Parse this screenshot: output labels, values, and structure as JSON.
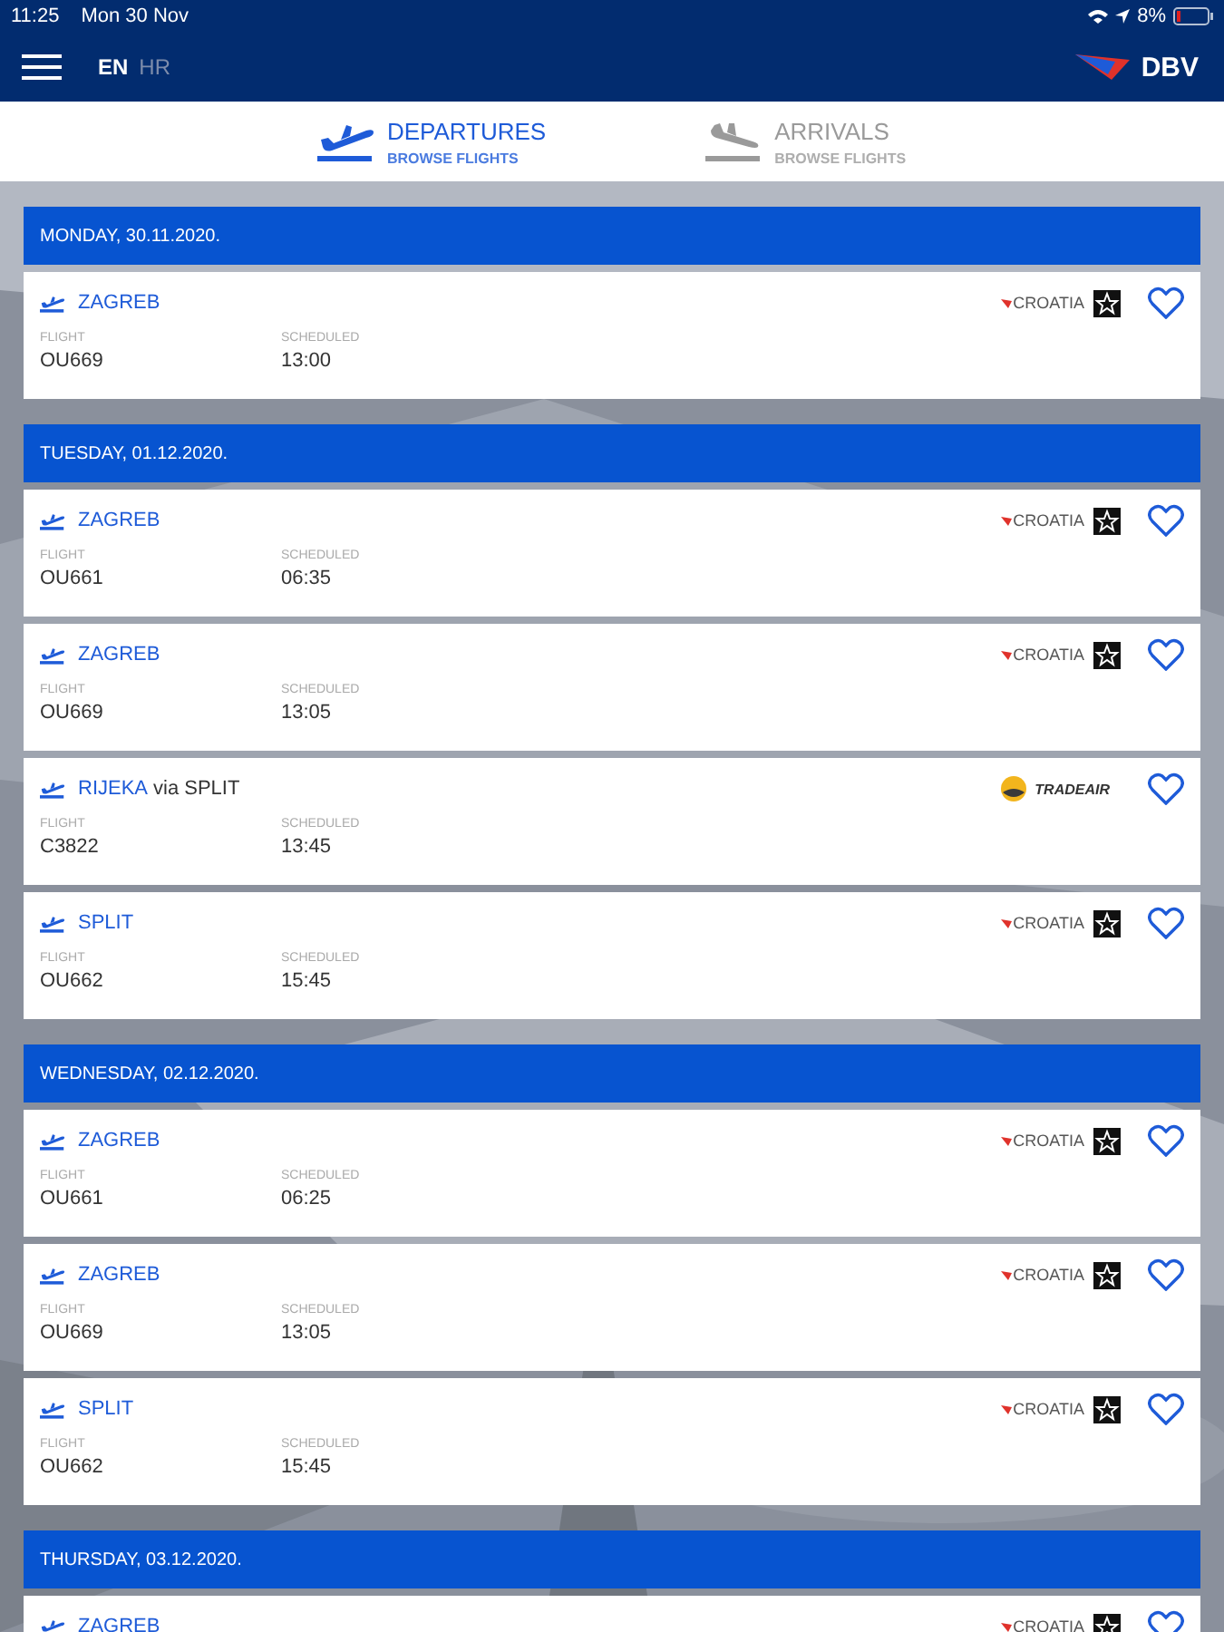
{
  "status_bar": {
    "time": "11:25",
    "date": "Mon 30 Nov",
    "battery": "8%"
  },
  "nav": {
    "languages": [
      {
        "label": "EN",
        "selected": true
      },
      {
        "label": "HR",
        "selected": false
      }
    ],
    "logo": "DBV"
  },
  "tabs": [
    {
      "kind": "departures",
      "label": "DEPARTURES",
      "sublabel": "BROWSE FLIGHTS",
      "selected": true
    },
    {
      "kind": "arrivals",
      "label": "ARRIVALS",
      "sublabel": "BROWSE FLIGHTS",
      "selected": false
    }
  ],
  "days": [
    {
      "date": "MONDAY, 30.11.2020.",
      "flights": [
        {
          "destination": "ZAGREB",
          "airline": {
            "kind": "croatia",
            "name": "CROATIA"
          },
          "flight_label": "FLIGHT",
          "flight": "OU669",
          "scheduled_label": "SCHEDULED",
          "scheduled": "13:00",
          "favorite": false
        }
      ]
    },
    {
      "date": "TUESDAY, 01.12.2020.",
      "flights": [
        {
          "destination": "ZAGREB",
          "airline": {
            "kind": "croatia",
            "name": "CROATIA"
          },
          "flight_label": "FLIGHT",
          "flight": "OU661",
          "scheduled_label": "SCHEDULED",
          "scheduled": "06:35",
          "favorite": false
        },
        {
          "destination": "ZAGREB",
          "airline": {
            "kind": "croatia",
            "name": "CROATIA"
          },
          "flight_label": "FLIGHT",
          "flight": "OU669",
          "scheduled_label": "SCHEDULED",
          "scheduled": "13:05",
          "favorite": false
        },
        {
          "destination": "RIJEKA",
          "via": "via SPLIT",
          "airline": {
            "kind": "tradeair",
            "name": "TRADEAIR"
          },
          "flight_label": "FLIGHT",
          "flight": "C3822",
          "scheduled_label": "SCHEDULED",
          "scheduled": "13:45",
          "favorite": false
        },
        {
          "destination": "SPLIT",
          "airline": {
            "kind": "croatia",
            "name": "CROATIA"
          },
          "flight_label": "FLIGHT",
          "flight": "OU662",
          "scheduled_label": "SCHEDULED",
          "scheduled": "15:45",
          "favorite": false
        }
      ]
    },
    {
      "date": "WEDNESDAY, 02.12.2020.",
      "flights": [
        {
          "destination": "ZAGREB",
          "airline": {
            "kind": "croatia",
            "name": "CROATIA"
          },
          "flight_label": "FLIGHT",
          "flight": "OU661",
          "scheduled_label": "SCHEDULED",
          "scheduled": "06:25",
          "favorite": false
        },
        {
          "destination": "ZAGREB",
          "airline": {
            "kind": "croatia",
            "name": "CROATIA"
          },
          "flight_label": "FLIGHT",
          "flight": "OU669",
          "scheduled_label": "SCHEDULED",
          "scheduled": "13:05",
          "favorite": false
        },
        {
          "destination": "SPLIT",
          "airline": {
            "kind": "croatia",
            "name": "CROATIA"
          },
          "flight_label": "FLIGHT",
          "flight": "OU662",
          "scheduled_label": "SCHEDULED",
          "scheduled": "15:45",
          "favorite": false
        }
      ]
    },
    {
      "date": "THURSDAY, 03.12.2020.",
      "flights": [
        {
          "destination": "ZAGREB",
          "airline": {
            "kind": "croatia",
            "name": "CROATIA"
          },
          "favorite": false
        }
      ]
    }
  ]
}
